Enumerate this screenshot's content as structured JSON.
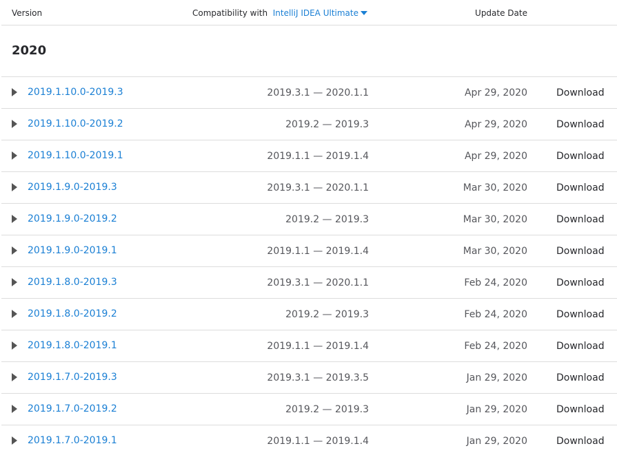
{
  "header": {
    "version_label": "Version",
    "compat_label": "Compatibility with",
    "product_selector": "IntelliJ IDEA Ultimate",
    "update_date_label": "Update Date"
  },
  "year_heading": "2020",
  "rows": [
    {
      "version": "2019.1.10.0-2019.3",
      "compat": "2019.3.1 — 2020.1.1",
      "date": "Apr 29, 2020",
      "download": "Download"
    },
    {
      "version": "2019.1.10.0-2019.2",
      "compat": "2019.2 — 2019.3",
      "date": "Apr 29, 2020",
      "download": "Download"
    },
    {
      "version": "2019.1.10.0-2019.1",
      "compat": "2019.1.1 — 2019.1.4",
      "date": "Apr 29, 2020",
      "download": "Download"
    },
    {
      "version": "2019.1.9.0-2019.3",
      "compat": "2019.3.1 — 2020.1.1",
      "date": "Mar 30, 2020",
      "download": "Download"
    },
    {
      "version": "2019.1.9.0-2019.2",
      "compat": "2019.2 — 2019.3",
      "date": "Mar 30, 2020",
      "download": "Download"
    },
    {
      "version": "2019.1.9.0-2019.1",
      "compat": "2019.1.1 — 2019.1.4",
      "date": "Mar 30, 2020",
      "download": "Download"
    },
    {
      "version": "2019.1.8.0-2019.3",
      "compat": "2019.3.1 — 2020.1.1",
      "date": "Feb 24, 2020",
      "download": "Download"
    },
    {
      "version": "2019.1.8.0-2019.2",
      "compat": "2019.2 — 2019.3",
      "date": "Feb 24, 2020",
      "download": "Download"
    },
    {
      "version": "2019.1.8.0-2019.1",
      "compat": "2019.1.1 — 2019.1.4",
      "date": "Feb 24, 2020",
      "download": "Download"
    },
    {
      "version": "2019.1.7.0-2019.3",
      "compat": "2019.3.1 — 2019.3.5",
      "date": "Jan 29, 2020",
      "download": "Download"
    },
    {
      "version": "2019.1.7.0-2019.2",
      "compat": "2019.2 — 2019.3",
      "date": "Jan 29, 2020",
      "download": "Download"
    },
    {
      "version": "2019.1.7.0-2019.1",
      "compat": "2019.1.1 — 2019.1.4",
      "date": "Jan 29, 2020",
      "download": "Download"
    }
  ]
}
